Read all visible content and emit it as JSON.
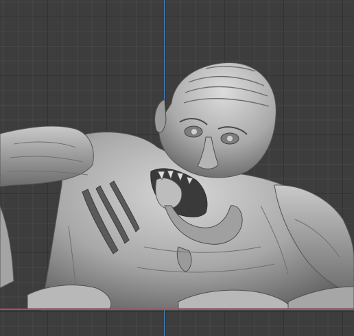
{
  "scene": {
    "object": "sculpt-mesh-zombie-bust",
    "colors": {
      "background": "#3d3d3d",
      "y_axis": "#3d84c6",
      "x_axis": "#b84a57",
      "mesh_light": "#d0d0d0",
      "mesh_mid": "#9a9a9a",
      "mesh_dark": "#4e4e4e"
    }
  }
}
